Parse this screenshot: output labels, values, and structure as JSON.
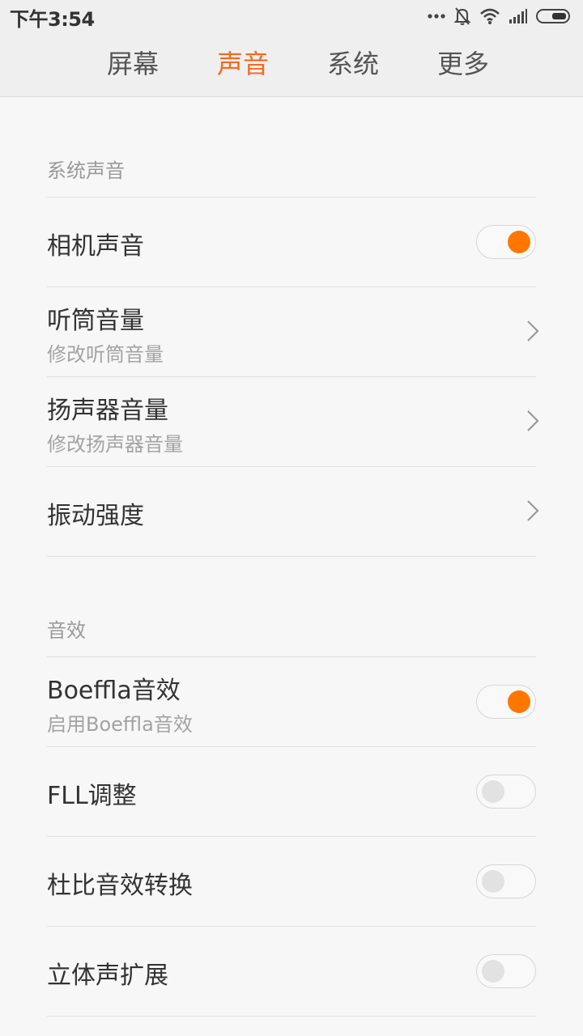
{
  "status_bar": {
    "time": "下午3:54",
    "icons": [
      "more-dots-icon",
      "bell-off-icon",
      "wifi-icon",
      "signal-icon",
      "battery-icon"
    ]
  },
  "tabs": [
    {
      "label": "屏幕",
      "active": false
    },
    {
      "label": "声音",
      "active": true
    },
    {
      "label": "系统",
      "active": false
    },
    {
      "label": "更多",
      "active": false
    }
  ],
  "sections": [
    {
      "header": "系统声音",
      "items": [
        {
          "title": "相机声音",
          "subtitle": "",
          "control": "toggle",
          "on": true
        },
        {
          "title": "听筒音量",
          "subtitle": "修改听筒音量",
          "control": "chevron"
        },
        {
          "title": "扬声器音量",
          "subtitle": "修改扬声器音量",
          "control": "chevron"
        },
        {
          "title": "振动强度",
          "subtitle": "",
          "control": "chevron"
        }
      ]
    },
    {
      "header": "音效",
      "items": [
        {
          "title": "Boeffla音效",
          "subtitle": "启用Boeffla音效",
          "control": "toggle",
          "on": true
        },
        {
          "title": "FLL调整",
          "subtitle": "",
          "control": "toggle",
          "on": false
        },
        {
          "title": "杜比音效转换",
          "subtitle": "",
          "control": "toggle",
          "on": false
        },
        {
          "title": "立体声扩展",
          "subtitle": "",
          "control": "toggle",
          "on": false
        }
      ]
    }
  ],
  "colors": {
    "accent": "#ff7700",
    "active_tab": "#f56a1e",
    "background": "#f7f7f7",
    "bar_background": "#efefef"
  }
}
